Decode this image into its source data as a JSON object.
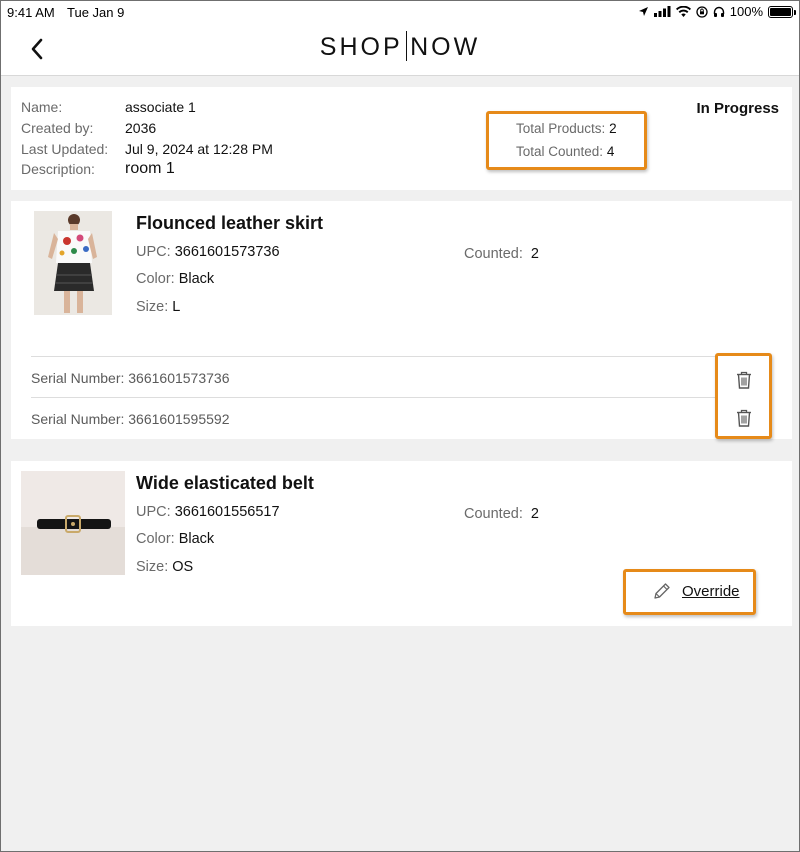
{
  "status_bar": {
    "time": "9:41 AM",
    "date": "Tue Jan 9",
    "battery": "100%",
    "icons": [
      "location-icon",
      "signal-icon",
      "wifi-icon",
      "lock-rotation-icon",
      "headphones-icon",
      "battery-icon"
    ]
  },
  "header": {
    "back_icon": "chevron-left-icon",
    "logo_left": "SHOP",
    "logo_right": "NOW"
  },
  "count_info": {
    "name_label": "Name:",
    "name": "associate 1",
    "created_by_label": "Created by:",
    "created_by": "2036",
    "last_updated_label": "Last Updated:",
    "last_updated": "Jul 9, 2024 at 12:28 PM",
    "description_label": "Description:",
    "description": "room 1",
    "status": "In Progress",
    "total_products_label": "Total Products:",
    "total_products": "2",
    "total_counted_label": "Total Counted:",
    "total_counted": "4"
  },
  "products": [
    {
      "title": "Flounced leather skirt",
      "upc_label": "UPC:",
      "upc": "3661601573736",
      "color_label": "Color:",
      "color": "Black",
      "size_label": "Size:",
      "size": "L",
      "counted_label": "Counted:",
      "counted": "2",
      "serials": [
        {
          "label": "Serial Number:",
          "value": "3661601573736"
        },
        {
          "label": "Serial Number:",
          "value": "3661601595592"
        }
      ]
    },
    {
      "title": "Wide elasticated belt",
      "upc_label": "UPC:",
      "upc": "3661601556517",
      "color_label": "Color:",
      "color": "Black",
      "size_label": "Size:",
      "size": "OS",
      "counted_label": "Counted:",
      "counted": "2",
      "override_label": "Override"
    }
  ],
  "colors": {
    "highlight": "#e68a19",
    "background": "#f0f0f0",
    "muted_text": "#6a6a6a"
  }
}
